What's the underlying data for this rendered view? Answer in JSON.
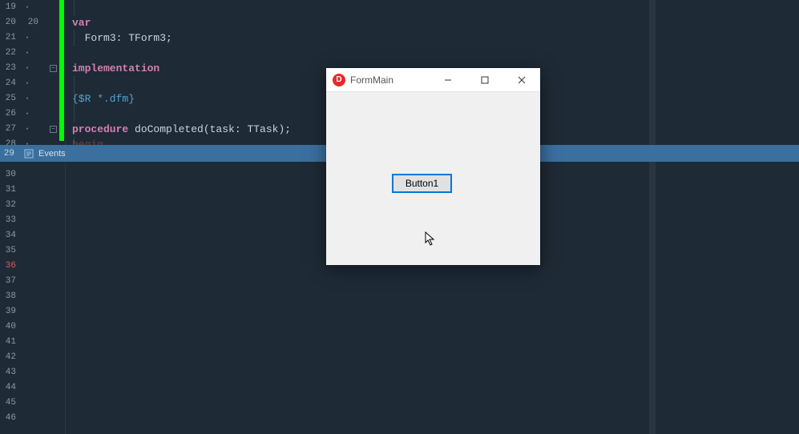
{
  "gutter": {
    "lines": [
      "19",
      "20",
      "21",
      "22",
      "23",
      "24",
      "25",
      "26",
      "27",
      "28",
      "29",
      "30",
      "31",
      "32",
      "33",
      "34",
      "35",
      "36",
      "37",
      "38",
      "39",
      "40",
      "41",
      "42",
      "43",
      "44",
      "45",
      "46"
    ],
    "secondary": {
      "l20": "20",
      "dot": "·"
    }
  },
  "code": {
    "l19": {
      "guide": true,
      "text": ""
    },
    "l20": {
      "kw": "var",
      "rest": ""
    },
    "l21": {
      "indent": "  ",
      "text": "Form3: TForm3;"
    },
    "l22": {
      "text": ""
    },
    "l23": {
      "kw": "implementation"
    },
    "l24": {
      "text": ""
    },
    "l25": {
      "directive": "{$R *.dfm}"
    },
    "l26": {
      "text": ""
    },
    "l27": {
      "kw": "procedure",
      "rest": " doCompleted(task: TTask);"
    },
    "l28": {
      "redkw": "begin"
    }
  },
  "events_panel": {
    "label": "Events"
  },
  "dialog": {
    "title": "FormMain",
    "button_label": "Button1"
  }
}
